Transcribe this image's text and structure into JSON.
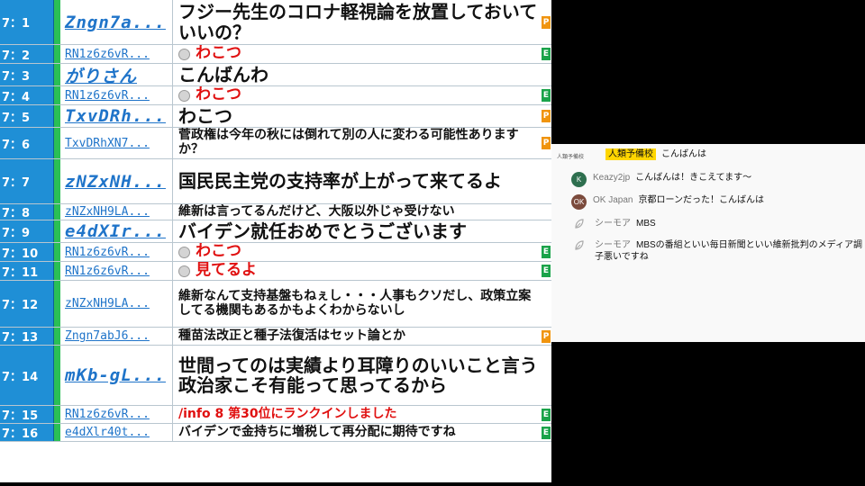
{
  "comments": [
    {
      "num": "7：1",
      "user": "Zngn7a...",
      "text": "フジー先生のコロナ軽視論を放置しておいていいの？",
      "badge": "P",
      "user_big": true,
      "size": "l",
      "red": false,
      "icon": false
    },
    {
      "num": "7：2",
      "user": "RN1z6z6vR...",
      "text": "わこつ",
      "badge": "E",
      "user_big": false,
      "size": "m",
      "red": true,
      "icon": true
    },
    {
      "num": "7：3",
      "user": "がりさん",
      "text": "こんばんわ",
      "badge": "",
      "user_big": true,
      "size": "l",
      "red": false,
      "icon": false
    },
    {
      "num": "7：4",
      "user": "RN1z6z6vR...",
      "text": "わこつ",
      "badge": "E",
      "user_big": false,
      "size": "m",
      "red": true,
      "icon": true
    },
    {
      "num": "7：5",
      "user": "TxvDRh...",
      "text": "わこつ",
      "badge": "P",
      "user_big": true,
      "size": "l",
      "red": false,
      "icon": false
    },
    {
      "num": "7：6",
      "user": "TxvDRhXN7...",
      "text": "菅政権は今年の秋には倒れて別の人に変わる可能性ありますか？",
      "badge": "P",
      "user_big": false,
      "size": "s",
      "red": false,
      "icon": false
    },
    {
      "num": "7：7",
      "user": "zNZxNH...",
      "text": "国民民主党の支持率が上がって来てるよ",
      "badge": "",
      "user_big": true,
      "size": "l",
      "red": false,
      "icon": false
    },
    {
      "num": "7：8",
      "user": "zNZxNH9LA...",
      "text": "維新は言ってるんだけど、大阪以外じゃ受けない",
      "badge": "",
      "user_big": false,
      "size": "s",
      "red": false,
      "icon": false
    },
    {
      "num": "7：9",
      "user": "e4dXIr...",
      "text": "バイデン就任おめでとうございます",
      "badge": "",
      "user_big": true,
      "size": "l",
      "red": false,
      "icon": false
    },
    {
      "num": "7：10",
      "user": "RN1z6z6vR...",
      "text": "わこつ",
      "badge": "E",
      "user_big": false,
      "size": "m",
      "red": true,
      "icon": true
    },
    {
      "num": "7：11",
      "user": "RN1z6z6vR...",
      "text": "見てるよ",
      "badge": "E",
      "user_big": false,
      "size": "m",
      "red": true,
      "icon": true
    },
    {
      "num": "7：12",
      "user": "zNZxNH9LA...",
      "text": "維新なんて支持基盤もねぇし・・・人事もクソだし、政策立案してる機関もあるかもよくわからないし",
      "badge": "",
      "user_big": false,
      "size": "s",
      "red": false,
      "icon": false
    },
    {
      "num": "7：13",
      "user": "Zngn7abJ6...",
      "text": "種苗法改正と種子法復活はセット論とか",
      "badge": "P",
      "user_big": false,
      "size": "s",
      "red": false,
      "icon": false
    },
    {
      "num": "7：14",
      "user": "mKb-gL...",
      "text": "世間ってのは実績より耳障りのいいこと言う政治家こそ有能って思ってるから",
      "badge": "",
      "user_big": true,
      "size": "l",
      "red": false,
      "icon": false
    },
    {
      "num": "7：15",
      "user": "RN1z6z6vR...",
      "text": "/info 8 第30位にランクインしました",
      "badge": "E",
      "user_big": false,
      "size": "s",
      "red": true,
      "icon": false
    },
    {
      "num": "7：16",
      "user": "e4dXlr40t...",
      "text": "バイデンで金持ちに増税して再分配に期待ですね",
      "badge": "E",
      "user_big": false,
      "size": "s",
      "red": false,
      "icon": false
    }
  ],
  "chat": [
    {
      "avatar_text": "人類予備校",
      "author": "人類予備校",
      "text": "こんばんは",
      "highlight": true,
      "avatar": "text",
      "color": ""
    },
    {
      "avatar_text": "K",
      "author": "Keazy2jp",
      "text": "こんばんは！きこえてます～",
      "highlight": false,
      "avatar": "letter",
      "color": "#2e6f4f"
    },
    {
      "avatar_text": "OK",
      "author": "OK Japan",
      "text": "京都ローンだった！こんばんは",
      "highlight": false,
      "avatar": "letter",
      "color": "#7b4a3c"
    },
    {
      "avatar_text": "",
      "author": "シーモア",
      "text": "MBS",
      "highlight": false,
      "avatar": "leaf",
      "color": ""
    },
    {
      "avatar_text": "",
      "author": "シーモア",
      "text": "MBSの番組といい毎日新聞といい維新批判のメディア調子悪いですね",
      "highlight": false,
      "avatar": "leaf",
      "color": ""
    }
  ]
}
